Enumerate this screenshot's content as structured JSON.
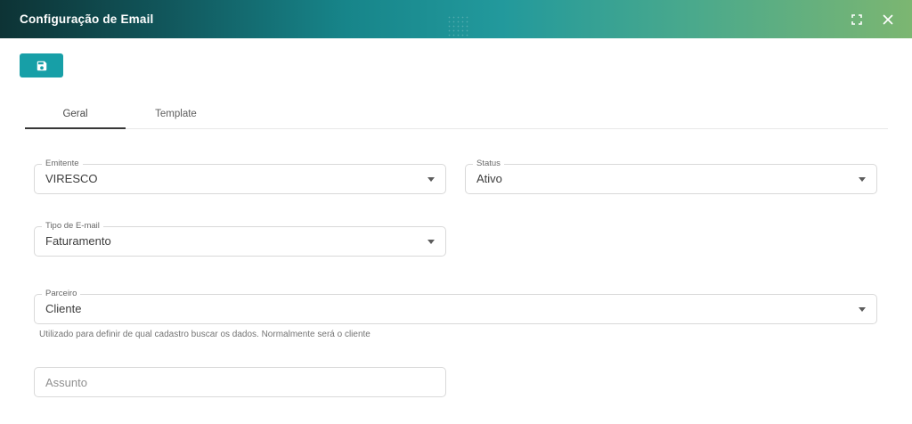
{
  "window": {
    "title": "Configuração de Email",
    "controls": {
      "fullscreen_icon": "fullscreen",
      "close_icon": "close"
    }
  },
  "toolbar": {
    "save_icon": "floppy-disk"
  },
  "tabs": {
    "items": [
      {
        "label": "Geral",
        "active": true
      },
      {
        "label": "Template",
        "active": false
      }
    ]
  },
  "form": {
    "fields": {
      "emitente": {
        "label": "Emitente",
        "value": "VIRESCO",
        "type": "select"
      },
      "status": {
        "label": "Status",
        "value": "Ativo",
        "type": "select"
      },
      "tipo_email": {
        "label": "Tipo de E-mail",
        "value": "Faturamento",
        "type": "select"
      },
      "parceiro": {
        "label": "Parceiro",
        "value": "Cliente",
        "type": "select",
        "helper": "Utilizado para definir de qual cadastro buscar os dados. Normalmente será o cliente"
      },
      "assunto": {
        "placeholder": "Assunto",
        "value": "",
        "type": "text"
      }
    }
  },
  "colors": {
    "header_gradient_start": "#0d3335",
    "header_gradient_mid": "#22999c",
    "header_gradient_end": "#7cb671",
    "accent_teal": "#179fa7",
    "tab_active_underline": "#373737"
  }
}
